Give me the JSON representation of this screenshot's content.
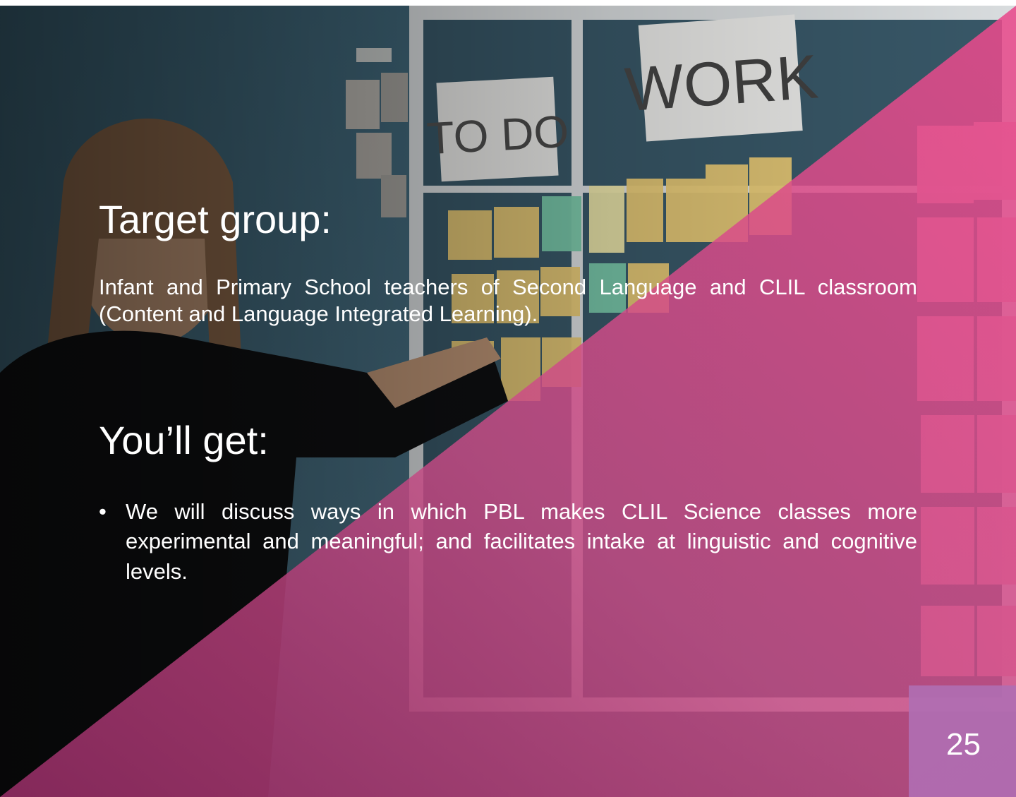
{
  "slide": {
    "board_labels": {
      "todo": "TO DO",
      "work": "WORK"
    },
    "colors": {
      "overlay_dark": "#7d2355",
      "overlay_pink": "#e0508c",
      "page_box": "#b06eb2"
    }
  },
  "target_group": {
    "heading": "Target group:",
    "text": "Infant and Primary School teachers of Second Language and CLIL classroom (Content and Language Integrated Learning)."
  },
  "youll_get": {
    "heading": "You’ll get:",
    "bullet_icon": "bullet-dot-icon",
    "bullets": [
      "We will discuss ways in which PBL makes CLIL Science classes more experimental and meaningful; and facilitates intake at linguistic and cognitive levels."
    ]
  },
  "page_number": "25"
}
